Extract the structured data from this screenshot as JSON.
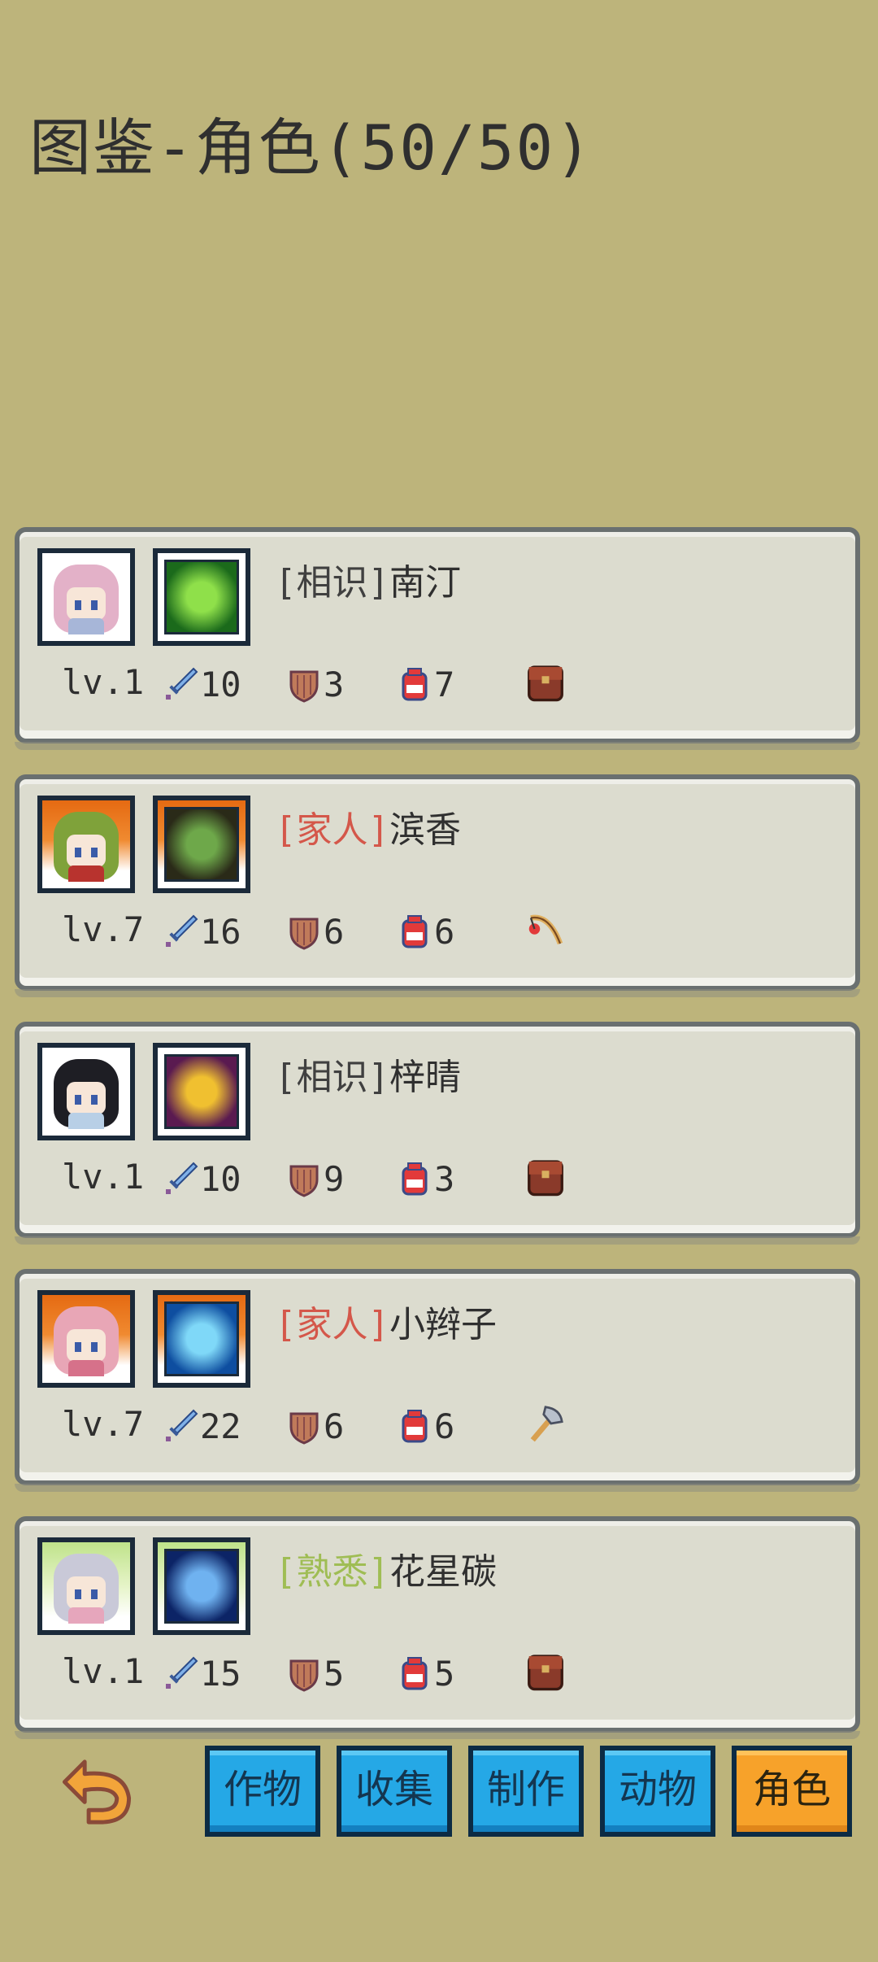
{
  "header": {
    "title": "图鉴-角色(50/50)"
  },
  "characters": [
    {
      "relation": "[相识]",
      "relation_type": "known",
      "name": "南汀",
      "level": "lv.1",
      "attack": "10",
      "defense": "3",
      "hp": "7",
      "tool_icon": "backpack-icon",
      "frame": "white",
      "hair_color": "#e3b1c8",
      "outfit_color": "#a7b6d8",
      "skill_colors": [
        "#1b6a1b",
        "#8fe04a"
      ]
    },
    {
      "relation": "[家人]",
      "relation_type": "family",
      "name": "滨香",
      "level": "lv.7",
      "attack": "16",
      "defense": "6",
      "hp": "6",
      "tool_icon": "fishing-rod-icon",
      "frame": "orange",
      "hair_color": "#7fa23a",
      "outfit_color": "#b8332e",
      "skill_colors": [
        "#2a2a18",
        "#6ea84a"
      ]
    },
    {
      "relation": "[相识]",
      "relation_type": "known",
      "name": "梓晴",
      "level": "lv.1",
      "attack": "10",
      "defense": "9",
      "hp": "3",
      "tool_icon": "backpack-icon",
      "frame": "white",
      "hair_color": "#1e1e24",
      "outfit_color": "#b8cfe6",
      "skill_colors": [
        "#5a1a50",
        "#f0c030"
      ]
    },
    {
      "relation": "[家人]",
      "relation_type": "family",
      "name": "小辫子",
      "level": "lv.7",
      "attack": "22",
      "defense": "6",
      "hp": "6",
      "tool_icon": "axe-icon",
      "frame": "orange",
      "hair_color": "#e8a6b6",
      "outfit_color": "#d6718a",
      "skill_colors": [
        "#0e4ea0",
        "#7fd8f8"
      ]
    },
    {
      "relation": "[熟悉]",
      "relation_type": "familiar",
      "name": "花星碳",
      "level": "lv.1",
      "attack": "15",
      "defense": "5",
      "hp": "5",
      "tool_icon": "backpack-icon",
      "frame": "green",
      "hair_color": "#c9c9d8",
      "outfit_color": "#e6a6bc",
      "skill_colors": [
        "#0c2466",
        "#6fb2f0"
      ]
    }
  ],
  "tabs": [
    {
      "label": "作物",
      "active": false
    },
    {
      "label": "收集",
      "active": false
    },
    {
      "label": "制作",
      "active": false
    },
    {
      "label": "动物",
      "active": false
    },
    {
      "label": "角色",
      "active": true
    }
  ],
  "colors": {
    "background": "#bdb47b",
    "tag_known": "#404040",
    "tag_family": "#d4574a",
    "tag_familiar": "#9fbd54",
    "tab_blue": "#25a8e6",
    "tab_active": "#f7a22a"
  }
}
